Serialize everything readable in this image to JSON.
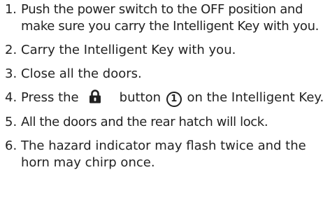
{
  "steps": [
    {
      "num": "1.",
      "text": "Push the power switch to the OFF position and make sure you carry the Intelligent Key with you."
    },
    {
      "num": "2.",
      "text": "Carry the Intelligent Key with you."
    },
    {
      "num": "3.",
      "text": "Close all the doors."
    },
    {
      "num": "4.",
      "before": "Press the",
      "after_icon": "button",
      "callout": "1",
      "after_callout": "on the Intelligent Key."
    },
    {
      "num": "5.",
      "text": "All the doors and the rear hatch will lock."
    },
    {
      "num": "6.",
      "text": "The hazard indicator may flash twice and the horn may chirp once."
    }
  ],
  "icons": {
    "lock_button": "padlock-icon"
  }
}
